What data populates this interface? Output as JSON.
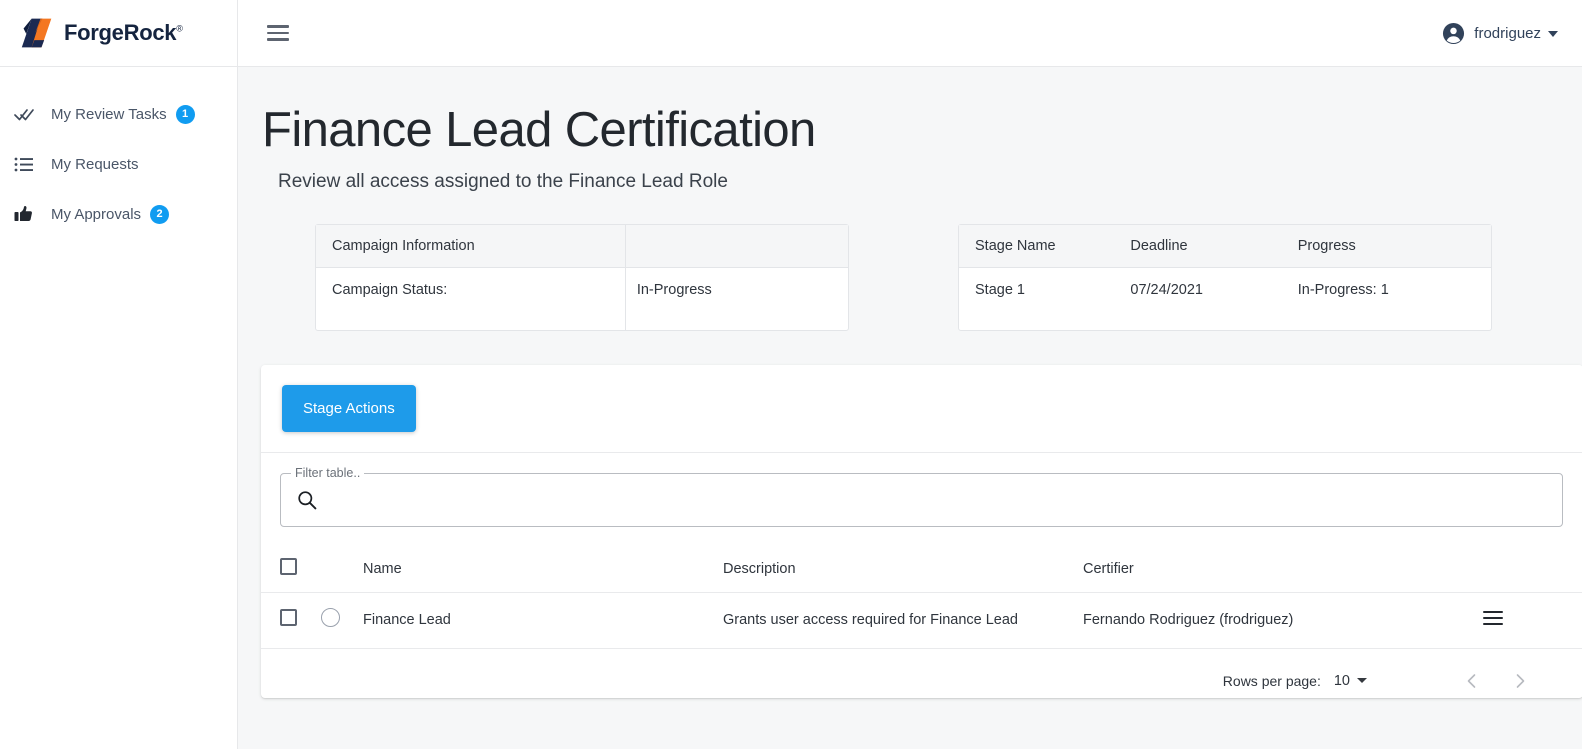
{
  "brand": {
    "name": "ForgeRock",
    "trademark": "®",
    "logo_icon": "forgerock-logo"
  },
  "topbar": {
    "menu_icon": "hamburger-menu-icon",
    "user": {
      "name": "frodriguez",
      "avatar_icon": "account-circle-icon",
      "chevron_icon": "chevron-down-icon"
    }
  },
  "sidebar": {
    "items": [
      {
        "label": "My Review Tasks",
        "icon": "double-check-icon",
        "badge": "1"
      },
      {
        "label": "My Requests",
        "icon": "list-icon",
        "badge": ""
      },
      {
        "label": "My Approvals",
        "icon": "thumbs-up-icon",
        "badge": "2"
      }
    ]
  },
  "page": {
    "title": "Finance Lead Certification",
    "subtitle": "Review all access assigned to the Finance Lead Role"
  },
  "campaign_card": {
    "header": "Campaign Information",
    "status_label": "Campaign Status:",
    "status_value": "In-Progress"
  },
  "stage_card": {
    "headers": [
      "Stage Name",
      "Deadline",
      "Progress"
    ],
    "row": [
      "Stage 1",
      "07/24/2021",
      "In-Progress: 1"
    ]
  },
  "panel": {
    "stage_actions_label": "Stage Actions",
    "filter": {
      "label": "Filter table..",
      "value": "",
      "placeholder": "",
      "search_icon": "search-icon"
    },
    "table": {
      "headers": [
        "Name",
        "Description",
        "Certifier"
      ],
      "select_all_icon": "checkbox-unchecked-icon",
      "rows": [
        {
          "checkbox_icon": "checkbox-unchecked-icon",
          "status_icon": "circle-outline-icon",
          "name": "Finance Lead",
          "description": "Grants user access required for Finance Lead",
          "certifier": "Fernando Rodriguez (frodriguez)",
          "row_menu_icon": "row-menu-icon"
        }
      ]
    },
    "pagination": {
      "rows_per_page_label": "Rows per page:",
      "rows_per_page_value": "10",
      "select_chevron_icon": "chevron-down-icon",
      "prev_icon": "chevron-left-icon",
      "next_icon": "chevron-right-icon"
    }
  },
  "colors": {
    "accent_blue": "#1e9bea",
    "badge_blue": "#109cf1",
    "brand_navy": "#15243f",
    "brand_orange": "#f47721",
    "page_background": "#f6f7f8"
  }
}
